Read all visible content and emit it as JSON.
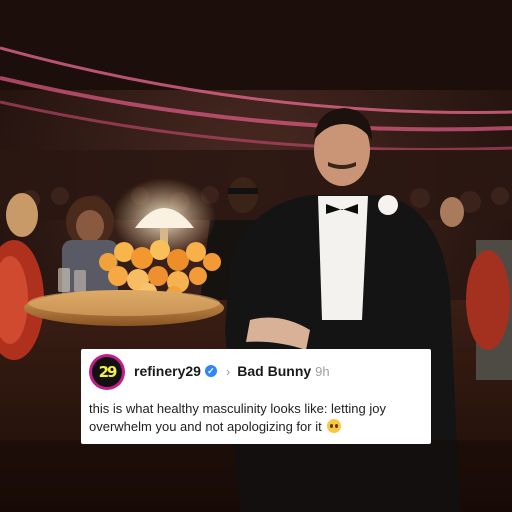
{
  "post": {
    "avatar_text": "29",
    "username": "refinery29",
    "verified_icon": "verified-badge-icon",
    "separator_icon": "chevron-right-icon",
    "reply_to": "Bad Bunny",
    "timestamp": "9h",
    "caption": "this is what healthy masculinity looks like: letting joy overwhelm you and not apologizing for it",
    "emoji_icon": "pleading-face-emoji",
    "colors": {
      "avatar_ring": "#c11e8b",
      "avatar_text": "#f4f04a",
      "verified": "#2f87f5"
    }
  }
}
